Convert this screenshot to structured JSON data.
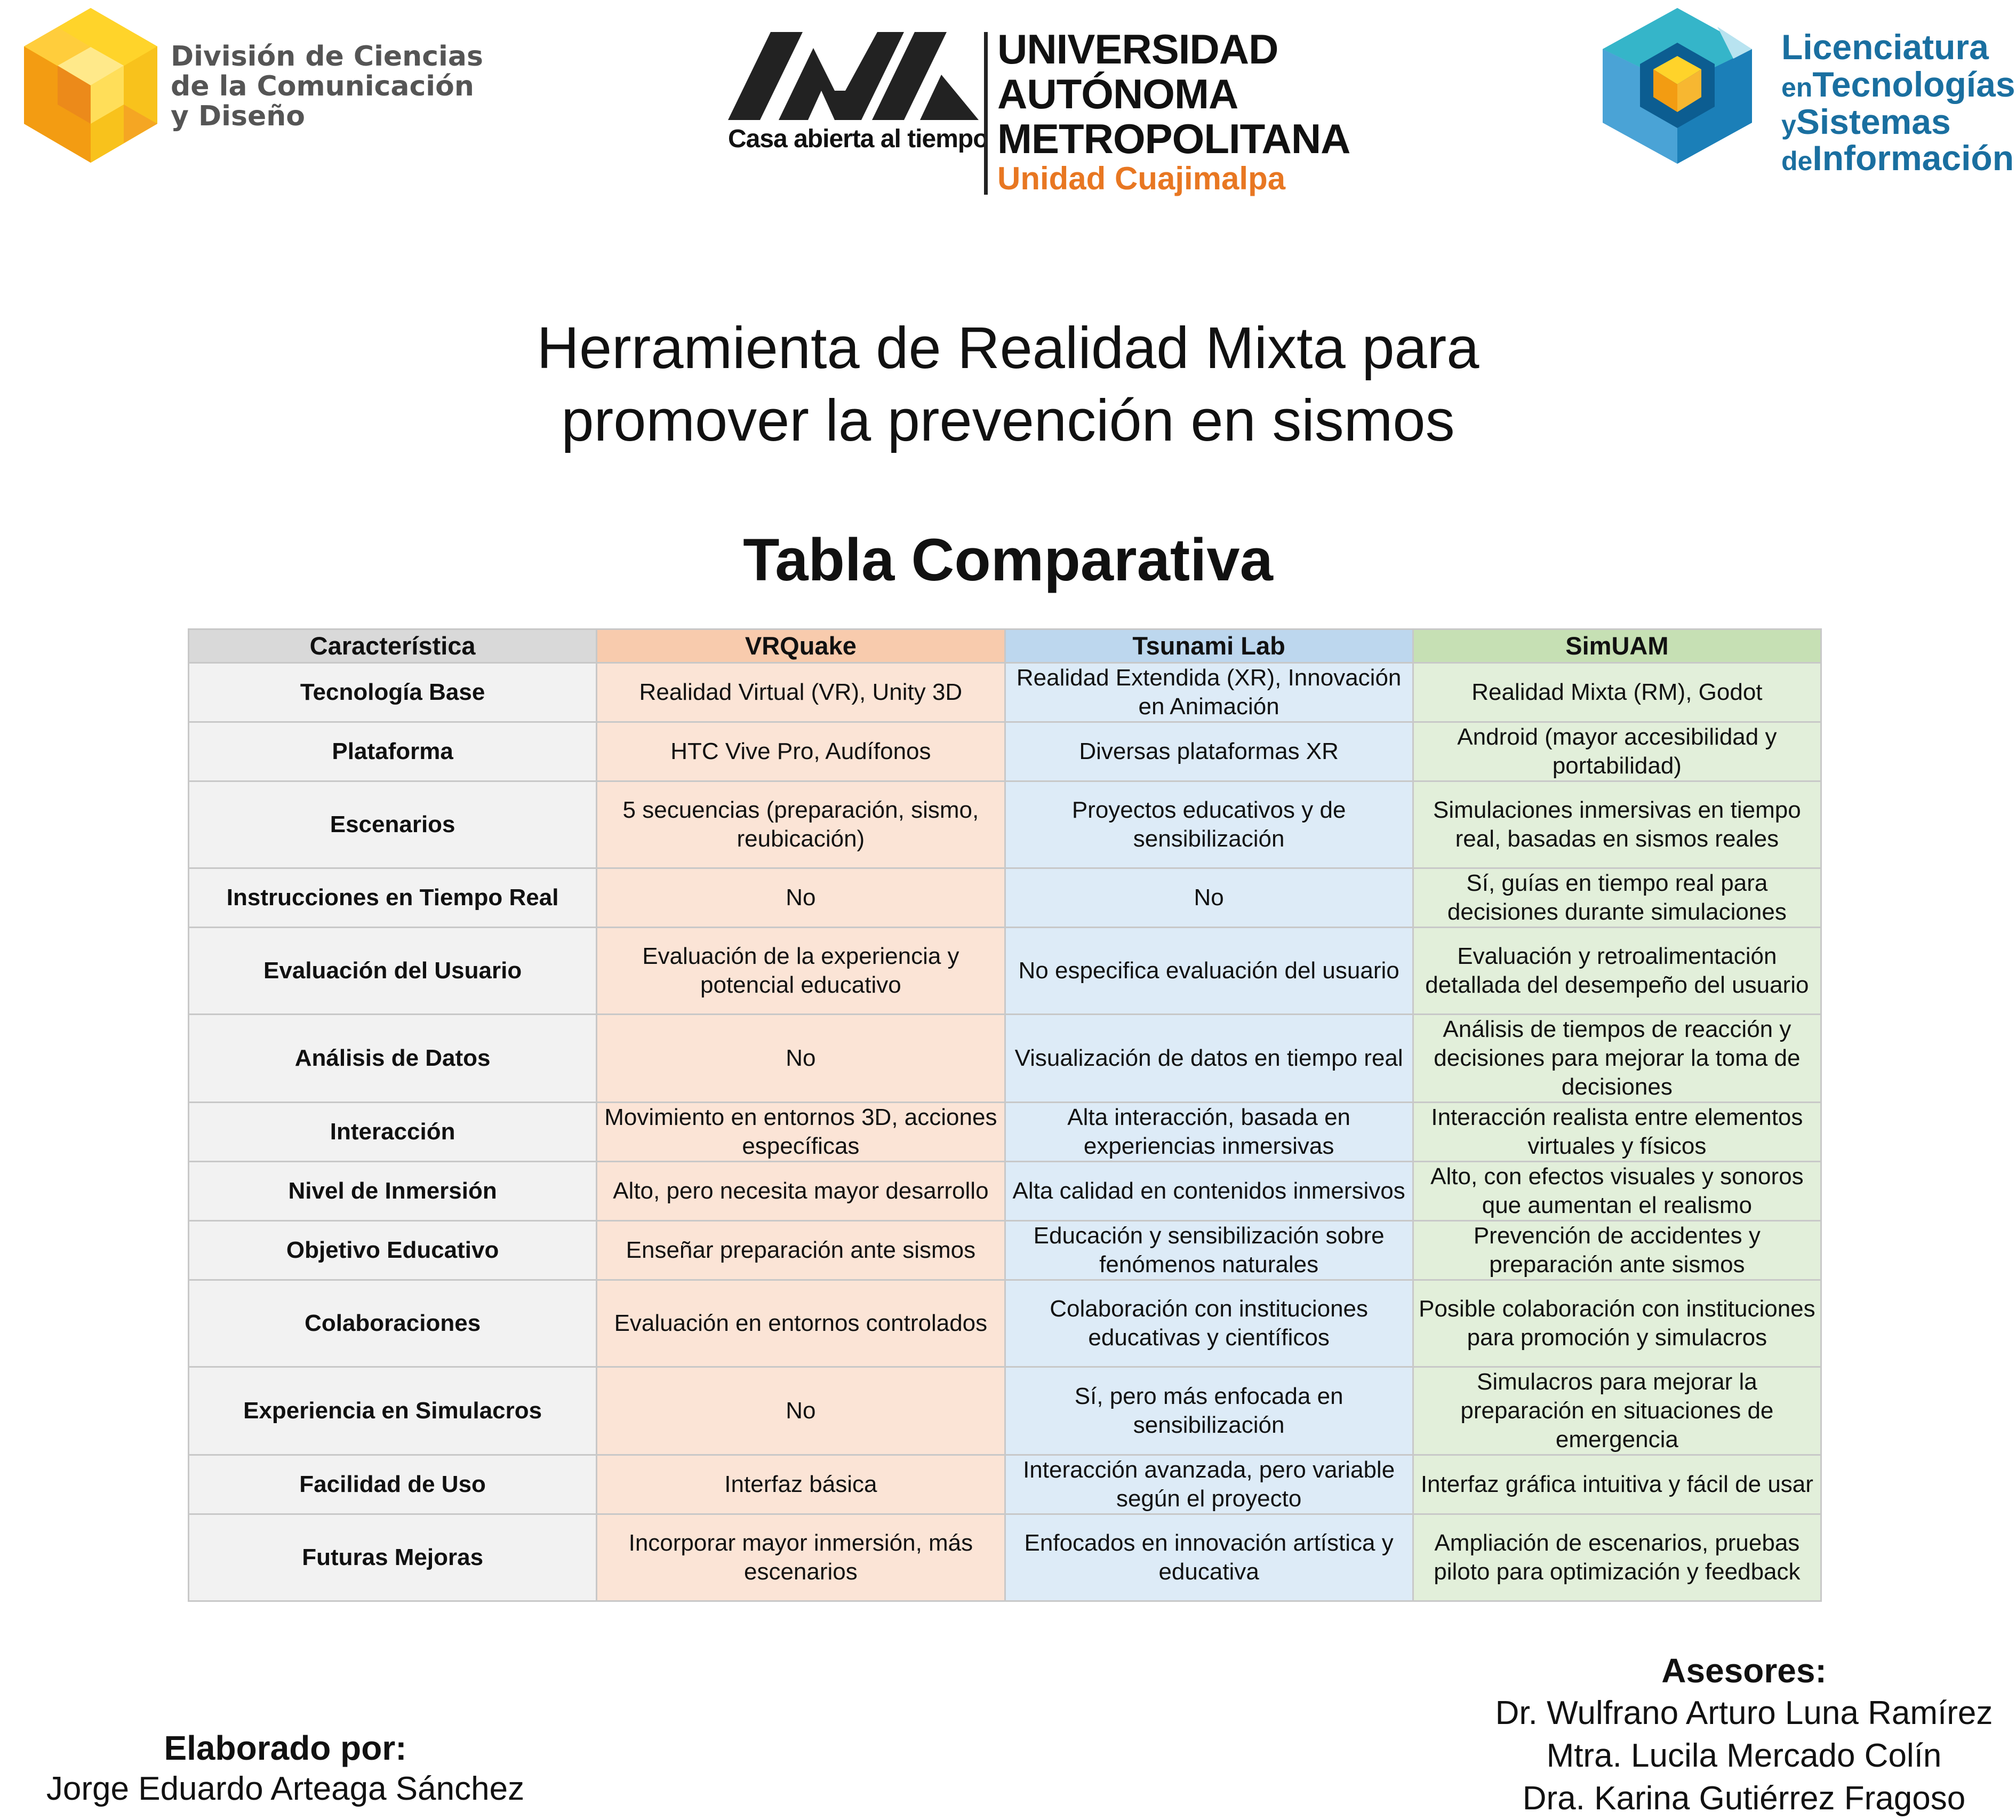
{
  "header": {
    "division_logo": {
      "lines": [
        "División de Ciencias",
        "de la Comunicación",
        "y Diseño"
      ]
    },
    "uam_logo": {
      "motto": "Casa abierta al tiempo",
      "name_lines": [
        "UNIVERSIDAD",
        "AUTÓNOMA",
        "METROPOLITANA"
      ],
      "unit": "Unidad Cuajimalpa"
    },
    "program_logo": {
      "line1": "Licenciatura",
      "line2_small": "en",
      "line2": "Tecnologías",
      "line3_small": "y",
      "line3": "Sistemas",
      "line4_small": "de",
      "line4": "Información"
    }
  },
  "title_lines": [
    "Herramienta de Realidad Mixta para",
    "promover la prevención en sismos"
  ],
  "subtitle": "Tabla Comparativa",
  "colors": {
    "header_gray": "#d9d9d9",
    "header_orange": "#f8cbad",
    "header_blue": "#bdd7ee",
    "header_green": "#c6e0b4",
    "cell_gray": "#f2f2f2",
    "cell_orange": "#fbe4d6",
    "cell_blue": "#ddebf7",
    "cell_green": "#e2efda",
    "uam_orange": "#e87722",
    "program_blue": "#1a6fa0"
  },
  "table": {
    "headers": [
      "Característica",
      "VRQuake",
      "Tsunami Lab",
      "SimUAM"
    ],
    "rows": [
      [
        "Tecnología Base",
        "Realidad Virtual (VR), Unity 3D",
        "Realidad Extendida (XR), Innovación en Animación",
        "Realidad Mixta (RM), Godot"
      ],
      [
        "Plataforma",
        "HTC Vive Pro, Audífonos",
        "Diversas plataformas XR",
        "Android (mayor accesibilidad y portabilidad)"
      ],
      [
        "Escenarios",
        "5 secuencias (preparación, sismo, reubicación)",
        "Proyectos educativos y de sensibilización",
        "Simulaciones inmersivas en tiempo real, basadas en sismos reales"
      ],
      [
        "Instrucciones en Tiempo Real",
        "No",
        "No",
        "Sí, guías en tiempo real para decisiones durante simulaciones"
      ],
      [
        "Evaluación del Usuario",
        "Evaluación de la experiencia y potencial educativo",
        "No especifica evaluación del usuario",
        "Evaluación y retroalimentación detallada del desempeño del usuario"
      ],
      [
        "Análisis de Datos",
        "No",
        "Visualización de datos en tiempo real",
        "Análisis de tiempos de reacción y decisiones para mejorar la toma de decisiones"
      ],
      [
        "Interacción",
        "Movimiento en entornos 3D, acciones específicas",
        "Alta interacción, basada en experiencias inmersivas",
        "Interacción realista entre elementos virtuales y físicos"
      ],
      [
        "Nivel de Inmersión",
        "Alto, pero necesita mayor desarrollo",
        "Alta calidad en contenidos inmersivos",
        "Alto, con efectos visuales y sonoros que aumentan el realismo"
      ],
      [
        "Objetivo Educativo",
        "Enseñar preparación ante sismos",
        "Educación y sensibilización sobre fenómenos naturales",
        "Prevención de accidentes y preparación ante sismos"
      ],
      [
        "Colaboraciones",
        "Evaluación en entornos controlados",
        "Colaboración con instituciones educativas y científicos",
        "Posible colaboración con instituciones para promoción y simulacros"
      ],
      [
        "Experiencia en Simulacros",
        "No",
        "Sí, pero más enfocada en sensibilización",
        "Simulacros para mejorar la preparación en situaciones de emergencia"
      ],
      [
        "Facilidad de Uso",
        "Interfaz básica",
        "Interacción avanzada, pero variable según el proyecto",
        "Interfaz gráfica intuitiva y fácil de usar"
      ],
      [
        "Futuras Mejoras",
        "Incorporar mayor inmersión, más escenarios",
        "Enfocados en innovación artística y educativa",
        "Ampliación de escenarios, pruebas piloto para optimización y feedback"
      ]
    ]
  },
  "footer": {
    "elaborado_label": "Elaborado por:",
    "elaborado_name": "Jorge Eduardo Arteaga Sánchez",
    "asesores_label": "Asesores:",
    "asesores": [
      "Dr. Wulfrano Arturo Luna Ramírez",
      "Mtra. Lucila Mercado Colín",
      "Dra. Karina Gutiérrez Fragoso"
    ]
  }
}
